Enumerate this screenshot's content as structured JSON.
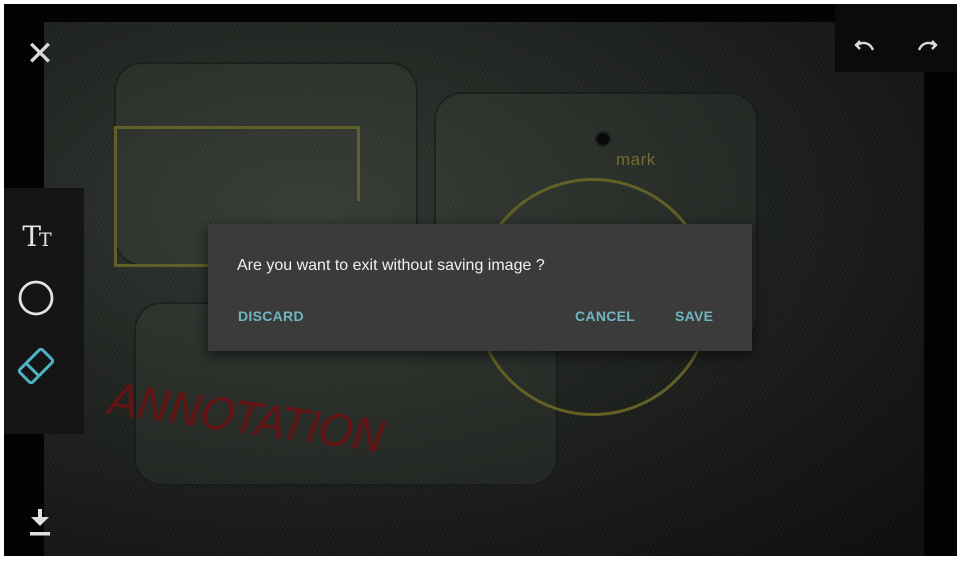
{
  "canvas": {
    "annotation_label": "mark",
    "annotation_text": "ANNOTATION"
  },
  "toolbar": {
    "close_icon": "close-icon",
    "undo_icon": "undo-icon",
    "redo_icon": "redo-icon",
    "tools": [
      {
        "name": "text-tool",
        "glyph": "Tт"
      },
      {
        "name": "circle-tool",
        "icon": "circle-icon"
      },
      {
        "name": "eraser-tool",
        "icon": "eraser-icon",
        "active": true
      }
    ],
    "download_icon": "download-icon"
  },
  "dialog": {
    "message": "Are you want to exit without saving image ?",
    "discard_label": "DISCARD",
    "cancel_label": "CANCEL",
    "save_label": "SAVE"
  },
  "colors": {
    "accent": "#6fb6c2",
    "dialog_bg": "#3b3b3b",
    "shape_annotation": "#8f8a35",
    "text_annotation": "#8c1d1d"
  }
}
